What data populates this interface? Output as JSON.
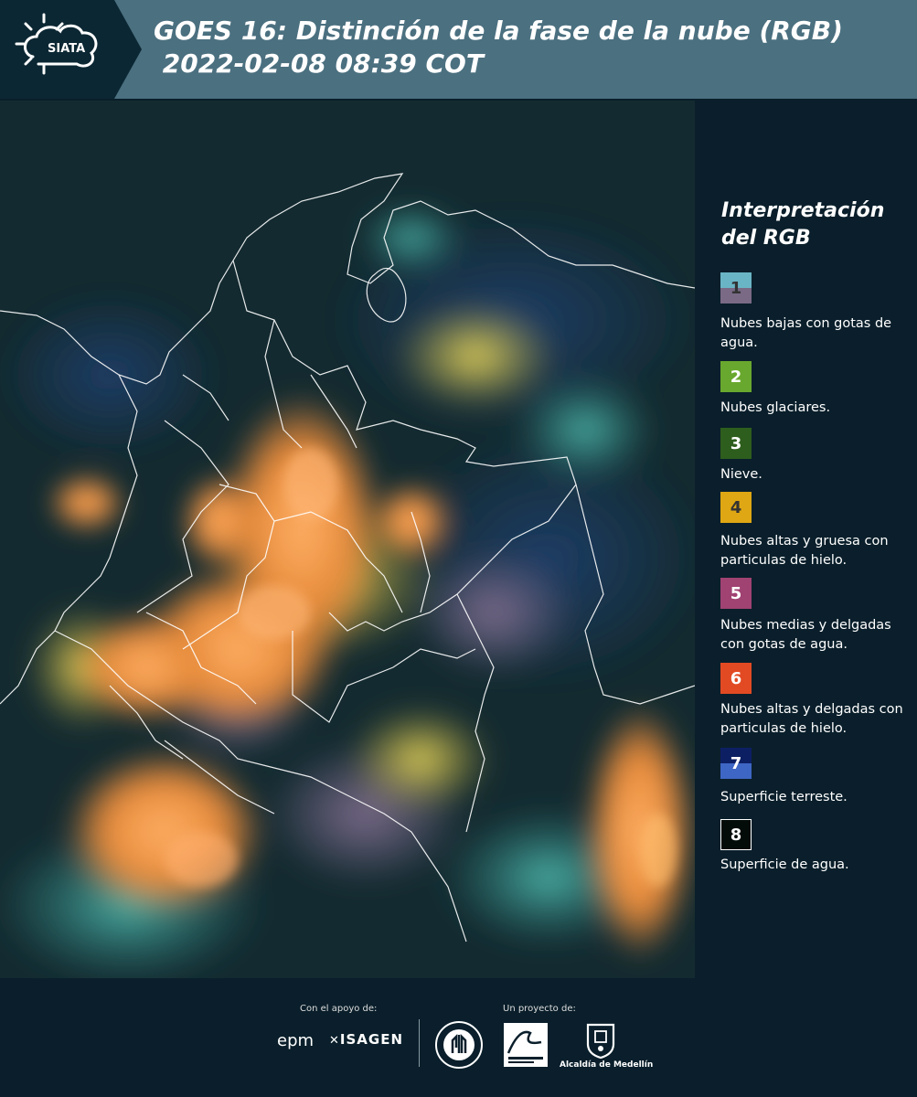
{
  "header": {
    "logo_text": "SIATA",
    "title": "GOES 16: Distinción de la fase de la nube (RGB)\n 2022-02-08 08:39 COT"
  },
  "legend": {
    "title": "Interpretación del RGB",
    "items": [
      {
        "number": "1",
        "label": "Nubes bajas con gotas de agua.",
        "colors": [
          "#6ab5c5",
          "#7a6a86"
        ]
      },
      {
        "number": "2",
        "label": "Nubes glaciares.",
        "colors": [
          "#69a82e"
        ]
      },
      {
        "number": "3",
        "label": "Nieve.",
        "colors": [
          "#2e5e1d"
        ]
      },
      {
        "number": "4",
        "label": "Nubes altas y gruesa con particulas de hielo.",
        "colors": [
          "#dfa713"
        ]
      },
      {
        "number": "5",
        "label": "Nubes medias y delgadas con gotas de agua.",
        "colors": [
          "#a04272"
        ]
      },
      {
        "number": "6",
        "label": "Nubes altas y delgadas con particulas de hielo.",
        "colors": [
          "#e24a23"
        ]
      },
      {
        "number": "7",
        "label": "Superficie terreste.",
        "colors": [
          "#0d1f63",
          "#3e66c4"
        ]
      },
      {
        "number": "8",
        "label": "Superficie de agua.",
        "colors": [
          "#040c0a"
        ]
      }
    ]
  },
  "footer": {
    "support_label": "Con el apoyo de:",
    "project_label": "Un proyecto de:",
    "sponsors": [
      "epm",
      "ISAGEN"
    ],
    "partners": [
      "Área Metropolitana Valle de Aburrá",
      "Alcaldía de Medellín"
    ],
    "alcaldia_label": "Alcaldía de Medellín"
  },
  "colors": {
    "header_bg": "#4b7080",
    "panel_bg": "#0a1f2b",
    "cloud_orange": "#f0923a",
    "cloud_yellow": "#d4c24a",
    "cloud_cyan": "#3fa7a0",
    "border_line": "#ffffff"
  }
}
